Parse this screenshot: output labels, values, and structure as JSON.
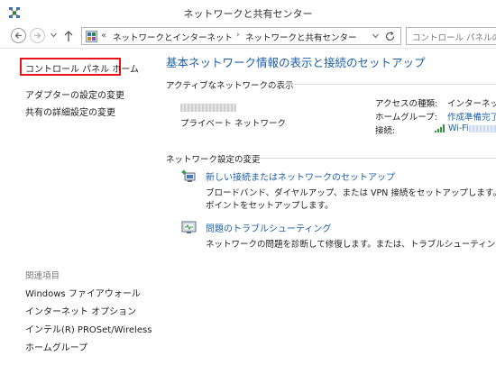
{
  "window": {
    "title": "ネットワークと共有センター"
  },
  "address": {
    "overflow": "«",
    "crumbs": [
      "ネットワークとインターネット",
      "ネットワークと共有センター"
    ]
  },
  "search": {
    "placeholder": "コントロール パネルの検"
  },
  "sidebar": {
    "home": "コントロール パネル ホーム",
    "links": [
      "アダプターの設定の変更",
      "共有の詳細設定の変更"
    ],
    "related_header": "関連項目",
    "related": [
      "Windows ファイアウォール",
      "インターネット オプション",
      "インテル(R) PROSet/Wireless",
      "ホームグループ"
    ]
  },
  "main": {
    "title": "基本ネットワーク情報の表示と接続のセットアップ",
    "active_header": "アクティブなネットワークの表示",
    "network_type": "プライベート ネットワーク",
    "access_label": "アクセスの種類:",
    "access_value": "インターネット アクセス",
    "homegroup_label": "ホームグループ:",
    "homegroup_value": "作成準備完了",
    "connection_label": "接続:",
    "connection_value": "Wi-Fi",
    "settings_header": "ネットワーク設定の変更",
    "tasks": [
      {
        "link": "新しい接続またはネットワークのセットアップ",
        "desc1": "ブロードバンド、ダイヤルアップ、または VPN 接続をセットアップします。あるいは、ルーター",
        "desc2": "ポイントをセットアップします。"
      },
      {
        "link": "問題のトラブルシューティング",
        "desc1": "ネットワークの問題を診断して修復します。または、トラブルシューティングに関する情報を"
      }
    ]
  },
  "colors": {
    "link": "#1b5fa8",
    "highlight_box": "#e8121b"
  }
}
